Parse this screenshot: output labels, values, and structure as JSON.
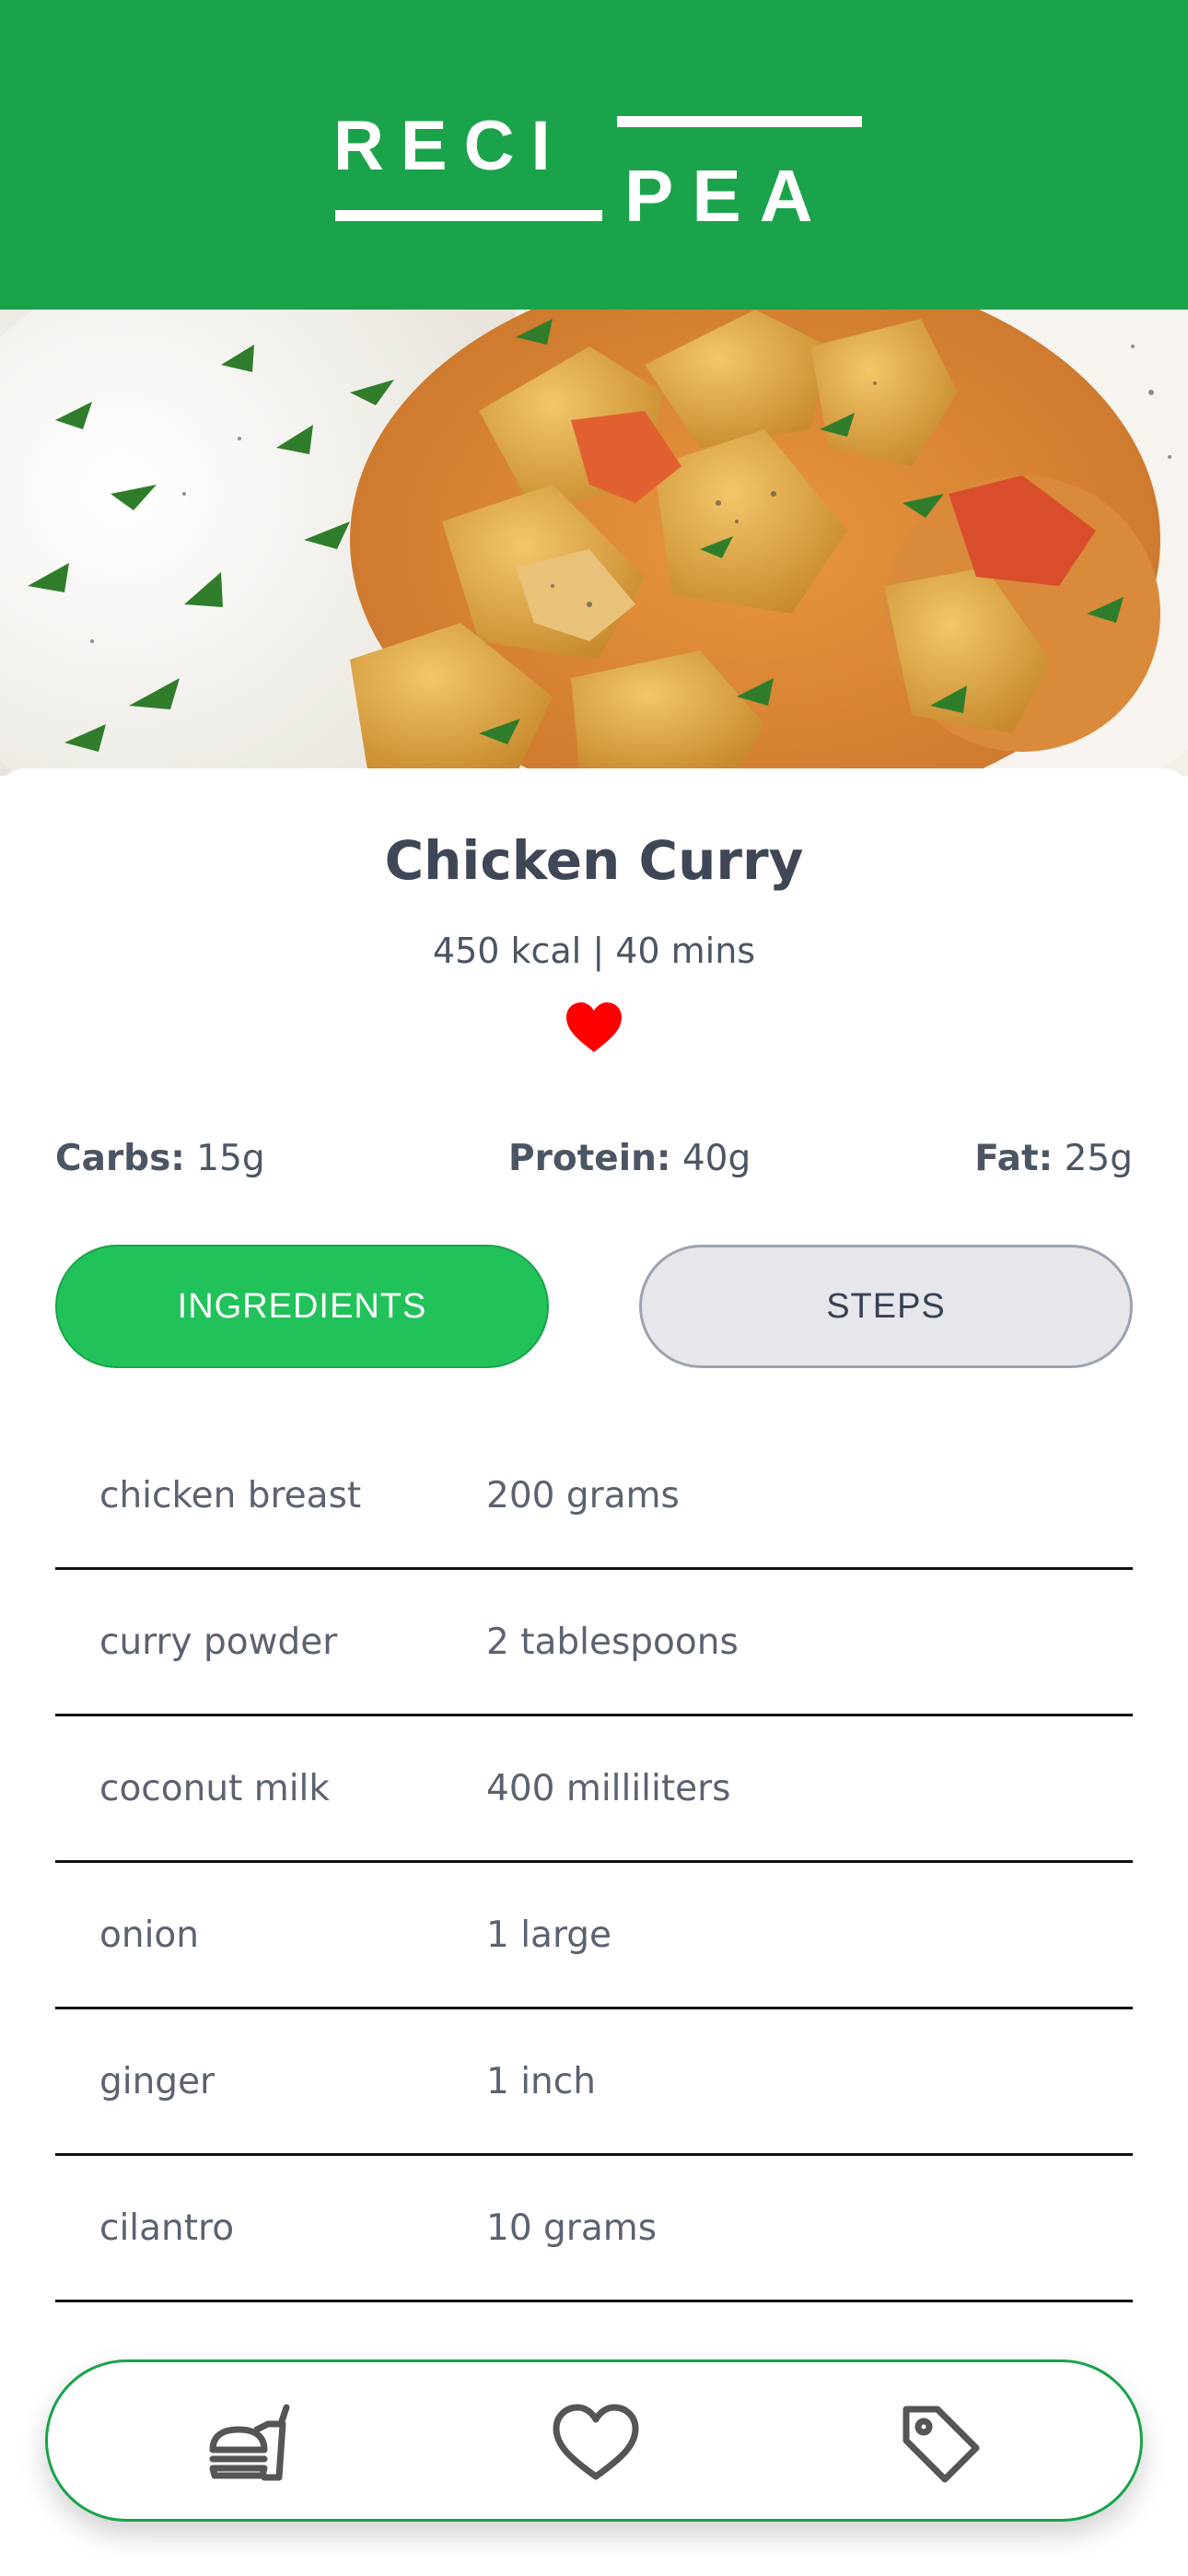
{
  "app": {
    "logo_text_top": "RECI",
    "logo_text_bottom": "PEA",
    "brand_color": "#1aa34a",
    "accent_color": "#22c25b"
  },
  "recipe": {
    "title": "Chicken Curry",
    "meta": "450 kcal | 40 mins",
    "favorite": true,
    "favorite_icon": "heart-filled-icon",
    "hero_image": "chicken-curry-with-rice-photo"
  },
  "macros": [
    {
      "label": "Carbs:",
      "value": " 15g"
    },
    {
      "label": "Protein:",
      "value": " 40g"
    },
    {
      "label": "Fat:",
      "value": " 25g"
    }
  ],
  "tabs": {
    "ingredients_label": "INGREDIENTS",
    "steps_label": "STEPS",
    "active": "ingredients"
  },
  "ingredients": [
    {
      "name": "chicken breast",
      "qty": "200 grams"
    },
    {
      "name": "curry powder",
      "qty": "2 tablespoons"
    },
    {
      "name": "coconut milk",
      "qty": "400 milliliters"
    },
    {
      "name": "onion",
      "qty": "1 large"
    },
    {
      "name": "ginger",
      "qty": "1 inch"
    },
    {
      "name": "cilantro",
      "qty": "10 grams"
    }
  ],
  "bottom_nav": {
    "items": [
      {
        "icon": "fast-food-icon"
      },
      {
        "icon": "heart-outline-icon"
      },
      {
        "icon": "tag-icon"
      }
    ]
  }
}
